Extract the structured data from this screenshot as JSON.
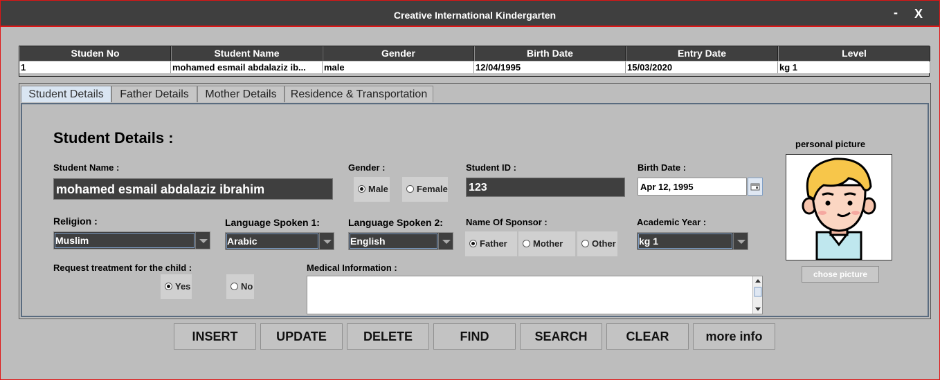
{
  "window": {
    "title": "Creative International Kindergarten",
    "minimize": "-",
    "close": "X"
  },
  "table": {
    "columns": [
      "Studen No",
      "Student Name",
      "Gender",
      "Birth Date",
      "Entry Date",
      "Level"
    ],
    "rows": [
      [
        "1",
        "mohamed esmail abdalaziz ib...",
        "male",
        "12/04/1995",
        "15/03/2020",
        "kg 1"
      ]
    ]
  },
  "tabs": [
    "Student Details",
    "Father Details",
    "Mother Details",
    "Residence & Transportation"
  ],
  "form": {
    "heading": "Student Details :",
    "student_name_label": "Student Name :",
    "student_name_value": "mohamed esmail abdalaziz ibrahim",
    "gender_label": "Gender :",
    "gender_options": [
      "Male",
      "Female"
    ],
    "gender_selected": "Male",
    "student_id_label": "Student ID :",
    "student_id_value": "123",
    "birth_date_label": "Birth Date :",
    "birth_date_value": "Apr 12, 1995",
    "religion_label": "Religion :",
    "religion_value": "Muslim",
    "language1_label": "Language Spoken 1:",
    "language1_value": "Arabic",
    "language2_label": "Language Spoken 2:",
    "language2_value": "English",
    "sponsor_label": "Name Of Sponsor :",
    "sponsor_options": [
      "Father",
      "Mother",
      "Other"
    ],
    "sponsor_selected": "Father",
    "academic_year_label": "Academic Year :",
    "academic_year_value": "kg 1",
    "treatment_label": "Request treatment for the child :",
    "treatment_options": [
      "Yes",
      "No"
    ],
    "treatment_selected": "Yes",
    "medical_label": "Medical Information :",
    "medical_value": "",
    "picture_label": "personal picture",
    "chose_picture": "chose picture"
  },
  "buttons": [
    "INSERT",
    "UPDATE",
    "DELETE",
    "FIND",
    "SEARCH",
    "CLEAR",
    "more info"
  ],
  "colors": {
    "title_bar": "#3f3f3f",
    "border_accent": "#e01515",
    "background": "#bdbdbd",
    "field_dark": "#3f3f3f",
    "tab_active": "#d9e5f2"
  },
  "icons": [
    "calendar-icon",
    "avatar-boy-icon",
    "radio-selected-icon",
    "combo-arrow-icon"
  ]
}
